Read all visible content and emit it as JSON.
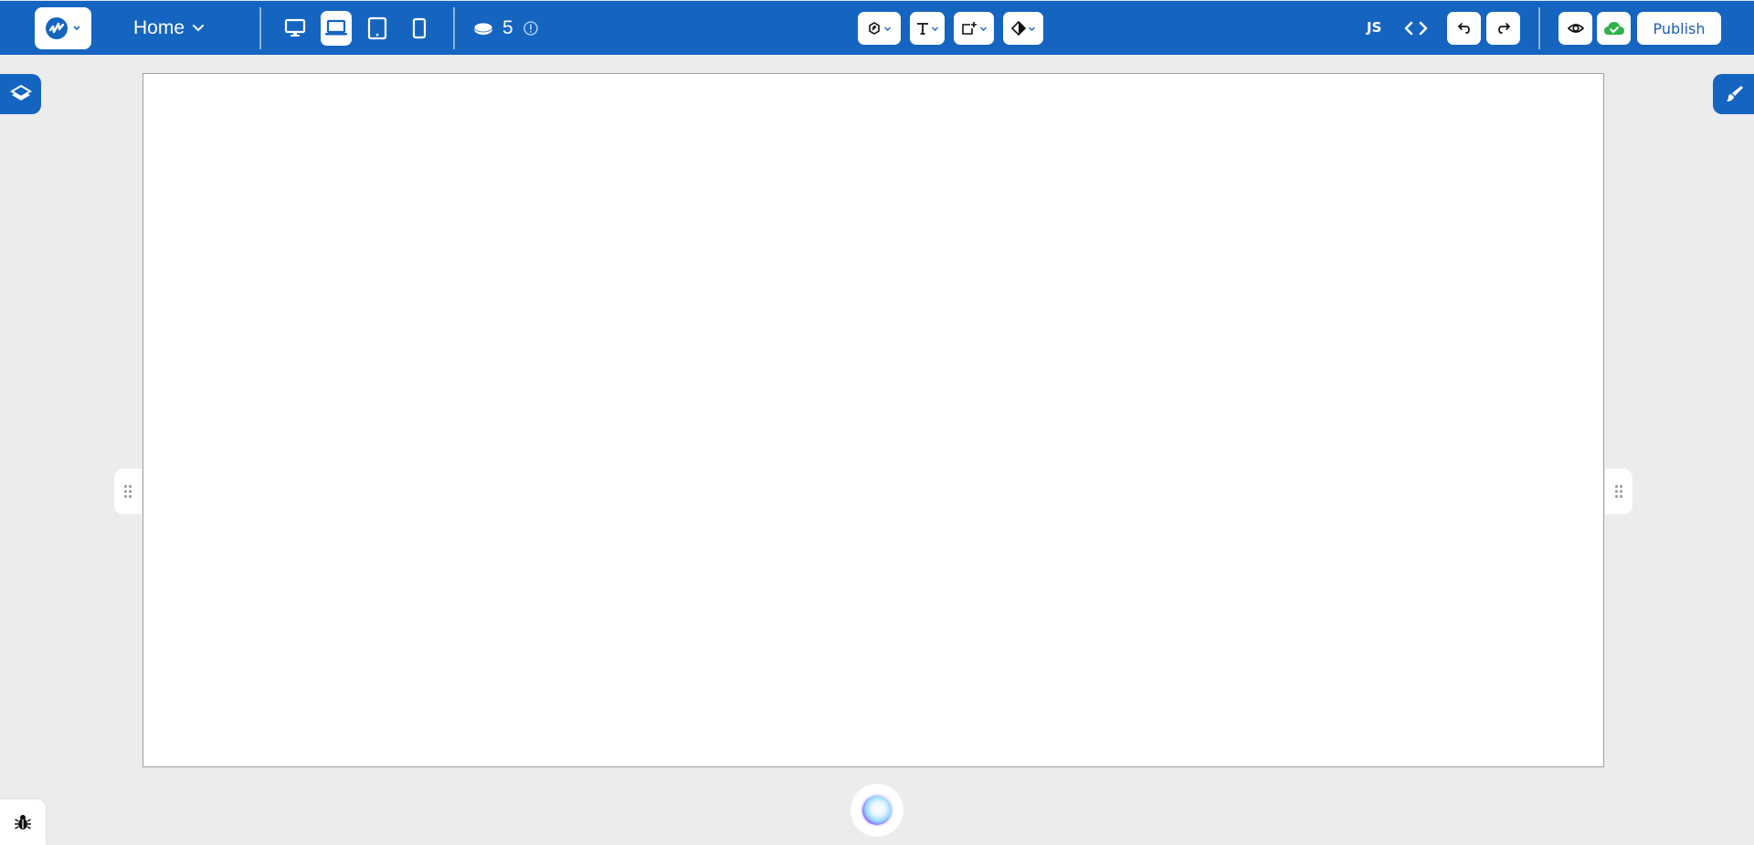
{
  "app": {
    "brand_color": "#1565c0",
    "canvas_background": "#ffffff",
    "workspace_background": "#ececec"
  },
  "topbar": {
    "logo": {
      "icon": "brand-logo-icon",
      "menu_icon": "chevron-down-icon"
    },
    "page_selector": {
      "label": "Home",
      "icon": "chevron-down-icon"
    },
    "devices": [
      {
        "name": "desktop",
        "icon": "desktop-icon",
        "active": false
      },
      {
        "name": "laptop",
        "icon": "laptop-icon",
        "active": true
      },
      {
        "name": "tablet",
        "icon": "tablet-icon",
        "active": false
      },
      {
        "name": "mobile",
        "icon": "mobile-icon",
        "active": false
      }
    ],
    "credits": {
      "icon": "coin-icon",
      "value": "5",
      "info_icon": "info-icon"
    },
    "tools": [
      {
        "name": "components",
        "icon": "components-icon"
      },
      {
        "name": "text",
        "icon": "text-icon"
      },
      {
        "name": "add-element",
        "icon": "add-element-icon"
      },
      {
        "name": "theme",
        "icon": "theme-icon"
      }
    ],
    "js_label": "JS",
    "code_icon": "code-icon",
    "undo_icon": "undo-icon",
    "redo_icon": "redo-icon",
    "preview_icon": "eye-icon",
    "save_status": {
      "icon": "cloud-check-icon",
      "color": "#2db34a"
    },
    "publish_label": "Publish"
  },
  "sidebars": {
    "left_button_icon": "layers-icon",
    "right_button_icon": "brush-icon"
  },
  "canvas": {
    "resize_handle_icon": "drag-handle-icon"
  },
  "footer": {
    "ai_assistant_icon": "ai-orb-icon",
    "debug_icon": "bug-icon"
  }
}
